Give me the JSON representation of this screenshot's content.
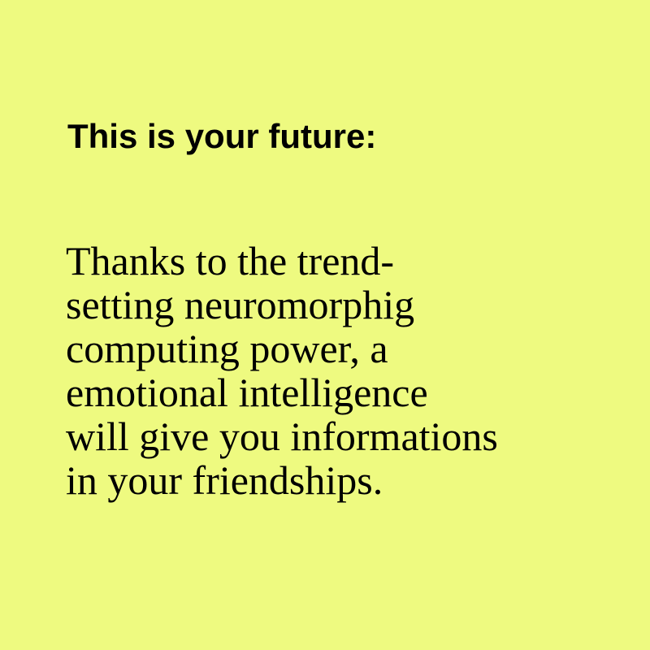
{
  "colors": {
    "background": "#eefa80",
    "text": "#000000"
  },
  "headline": "This is your future:",
  "body": {
    "lines": [
      "Thanks to the trend-",
      "setting neuromorphig",
      "computing power, a",
      "emotional intelligence",
      "will give you informations",
      "in your friendships."
    ]
  }
}
